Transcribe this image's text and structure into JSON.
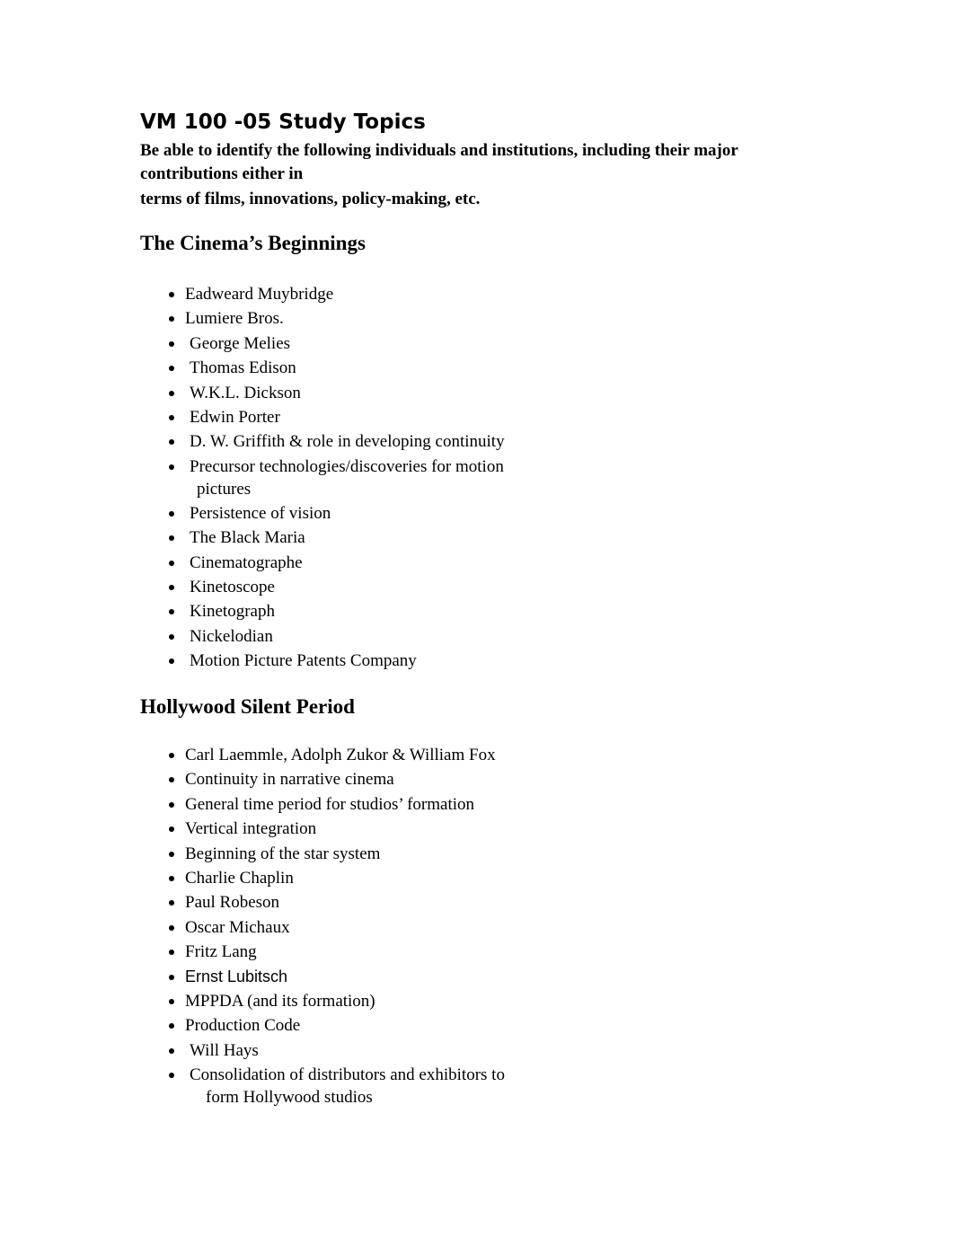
{
  "document": {
    "title": "VM 100 -05 Study Topics",
    "intro_line1": "Be able to identify the following individuals and institutions, including their major contributions either in",
    "intro_line2": "terms of films, innovations, policy-making, etc."
  },
  "sections": [
    {
      "heading": "The Cinema’s Beginnings",
      "items": [
        {
          "text": "Eadweard Muybridge"
        },
        {
          "text": "Lumiere Bros."
        },
        {
          "text": "George Melies"
        },
        {
          "text": "Thomas Edison"
        },
        {
          "text": "W.K.L. Dickson"
        },
        {
          "text": "Edwin Porter"
        },
        {
          "text": "D. W. Griffith & role in developing continuity"
        },
        {
          "text": "Precursor technologies/discoveries for motion",
          "continuation": "pictures"
        },
        {
          "text": "Persistence of vision"
        },
        {
          "text": "The Black Maria"
        },
        {
          "text": "Cinematographe"
        },
        {
          "text": "Kinetoscope"
        },
        {
          "text": "Kinetograph"
        },
        {
          "text": "Nickelodian"
        },
        {
          "text": "Motion Picture Patents Company"
        }
      ]
    },
    {
      "heading": "Hollywood Silent Period",
      "items": [
        {
          "text": "Carl Laemmle, Adolph Zukor & William Fox"
        },
        {
          "text": "Continuity in narrative cinema"
        },
        {
          "text": "General time period for studios’ formation"
        },
        {
          "text": "Vertical integration"
        },
        {
          "text": "Beginning of the star system"
        },
        {
          "text": "Charlie Chaplin"
        },
        {
          "text": "Paul Robeson"
        },
        {
          "text": "Oscar Michaux"
        },
        {
          "text": "Fritz Lang"
        },
        {
          "text": "Ernst Lubitsch"
        },
        {
          "text": "MPPDA (and its formation)"
        },
        {
          "text": "Production Code"
        },
        {
          "text": "Will Hays"
        },
        {
          "text": "Consolidation of distributors and exhibitors to",
          "continuation": "form Hollywood studios"
        }
      ]
    }
  ]
}
